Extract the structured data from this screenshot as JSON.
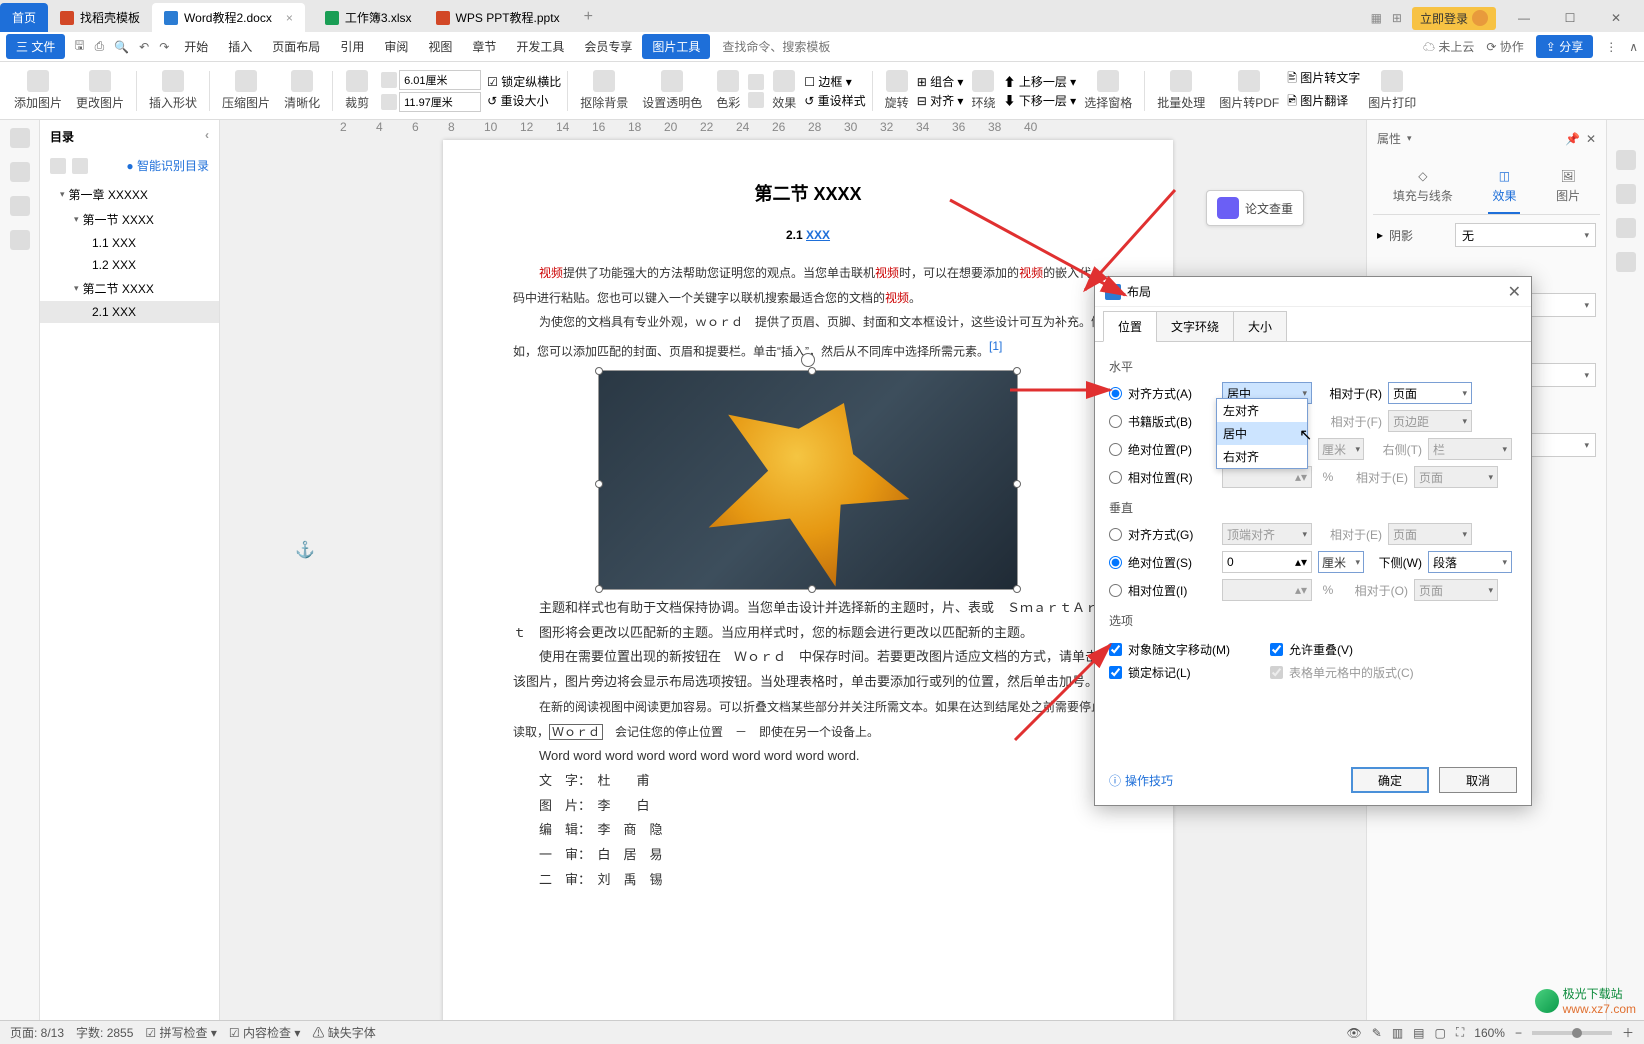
{
  "titlebar": {
    "home": "首页",
    "tabs": [
      {
        "label": "找稻壳模板"
      },
      {
        "label": "Word教程2.docx",
        "active": true
      },
      {
        "label": "工作簿3.xlsx"
      },
      {
        "label": "WPS PPT教程.pptx"
      }
    ],
    "login": "立即登录"
  },
  "menubar": {
    "file": "三 文件",
    "items": [
      "开始",
      "插入",
      "页面布局",
      "引用",
      "审阅",
      "视图",
      "章节",
      "开发工具",
      "会员专享"
    ],
    "active": "图片工具",
    "search_placeholder": "查找命令、搜索模板",
    "right": {
      "cloud": "未上云",
      "coop": "协作",
      "share": "分享"
    }
  },
  "ribbon": {
    "addpic": "添加图片",
    "editpic": "更改图片",
    "insertshape": "插入形状",
    "compress": "压缩图片",
    "clarity": "清晰化",
    "crop": "裁剪",
    "w": "6.01厘米",
    "h": "11.97厘米",
    "lock": "锁定纵横比",
    "resetsize": "重设大小",
    "rmBg": "抠除背景",
    "transColor": "设置透明色",
    "color": "色彩",
    "effect": "效果",
    "resetStyle": "重设样式",
    "rotate": "旋转",
    "combine": "组合",
    "align": "对齐",
    "wrap": "环绕",
    "up": "上移一层",
    "down": "下移一层",
    "selpane": "选择窗格",
    "batch": "批量处理",
    "toPdf": "图片转PDF",
    "toText": "图片转文字",
    "imgTrans": "图片翻译",
    "imgPrint": "图片打印"
  },
  "outline": {
    "title": "目录",
    "smart": "智能识别目录",
    "items": [
      {
        "level": 1,
        "label": "第一章 XXXXX",
        "exp": true
      },
      {
        "level": 2,
        "label": "第一节 XXXX",
        "exp": true
      },
      {
        "level": 3,
        "label": "1.1 XXX"
      },
      {
        "level": 3,
        "label": "1.2 XXX"
      },
      {
        "level": 2,
        "label": "第二节 XXXX",
        "exp": true
      },
      {
        "level": 3,
        "label": "2.1 XXX",
        "sel": true
      }
    ]
  },
  "document": {
    "chapter": "第二节  XXXX",
    "section_num": "2.1 ",
    "section_title": "XXX",
    "p1_a": "视频",
    "p1_b": "提供了功能强大的方法帮助您证明您的观点。当您单击联机",
    "p1_c": "视频",
    "p1_d": "时，可以在想要添加的",
    "p1_e": "视频",
    "p1_f": "的嵌入代码中进行粘贴。您也可以键入一个关键字以联机搜索最适合您的文档的",
    "p1_g": "视频",
    "p1_h": "。",
    "p2": "为使您的文档具有专业外观，ｗｏｒｄ　提供了页眉、页脚、封面和文本框设计，这些设计可互为补充。例如，您可以添加匹配的封面、页眉和提要栏。单击“插入”，然后从不同库中选择所需元素。",
    "p3": "主题和样式也有助于文档保持协调。当您单击设计并选择新的主题时，片、表或　ＳｍａｒｔＡｒｔ　图形将会更改以匹配新的主题。当应用样式时，您的标题会进行更改以匹配新的主题。",
    "p4_a": "使用在需要位置出现的新按钮在　Ｗｏｒｄ　中保存时间。若要更改图片适应文档的方式，请单击该图片，图片旁边将会显示布局选项按钮。当处理表格时，单击要添加行或列的位置，然后单击加号。",
    "p5_a": "在新的阅读视图中阅读更加容易。可以折叠文档某些部分并关注所需文本。如果在达到结尾处之前需要停止读取，",
    "p5_word": "Ｗｏｒｄ",
    "p5_b": "　会记住您的停止位置　－　即使在另一个设备上。",
    "p6": "Word word word word word word word word word word.",
    "meta": [
      "文　字：　杜　　甫",
      "图　片：　李　　白",
      "编　辑：　李　商　隐",
      "一　审：　白　居　易",
      "二　审：　刘　禹　锡"
    ]
  },
  "checkBtn": "论文查重",
  "props": {
    "title": "属性",
    "tabs": [
      "填充与线条",
      "效果",
      "图片"
    ],
    "shadow_lbl": "阴影",
    "shadow_val": "无",
    "none": "无"
  },
  "dialog": {
    "title": "布局",
    "tabs": [
      "位置",
      "文字环绕",
      "大小"
    ],
    "sect_h": "水平",
    "sect_v": "垂直",
    "sect_opt": "选项",
    "alignA": "对齐方式(A)",
    "alignA_val": "居中",
    "alignA_r": "相对于(R)",
    "alignA_r_val": "页面",
    "bookB": "书籍版式(B)",
    "bookB_r": "相对于(F)",
    "bookB_r_val": "页边距",
    "absP": "绝对位置(P)",
    "absP_unit": "厘米",
    "absP_r": "右侧(T)",
    "absP_r_val": "栏",
    "relR": "相对位置(R)",
    "relR_unit": "%",
    "relR_r": "相对于(E)",
    "relR_r_val": "页面",
    "valignG": "对齐方式(G)",
    "valignG_val": "顶端对齐",
    "valignG_r": "相对于(E)",
    "valignG_r_val": "页面",
    "vAbsS": "绝对位置(S)",
    "vAbsS_val": "0",
    "vAbsS_unit": "厘米",
    "vAbsS_r": "下侧(W)",
    "vAbsS_r_val": "段落",
    "vRelI": "相对位置(I)",
    "vRelI_unit": "%",
    "vRelI_r": "相对于(O)",
    "vRelI_r_val": "页面",
    "opt1": "对象随文字移动(M)",
    "opt2": "锁定标记(L)",
    "opt3": "允许重叠(V)",
    "opt4": "表格单元格中的版式(C)",
    "tips": "操作技巧",
    "ok": "确定",
    "cancel": "取消",
    "dropdown": [
      "左对齐",
      "居中",
      "右对齐"
    ]
  },
  "statusbar": {
    "page": "页面: 8/13",
    "words": "字数: 2855",
    "spell": "拼写检查",
    "content": "内容检查",
    "font": "缺失字体",
    "zoom": "160%"
  },
  "watermark": {
    "name": "极光下载站",
    "url": "www.xz7.com"
  }
}
